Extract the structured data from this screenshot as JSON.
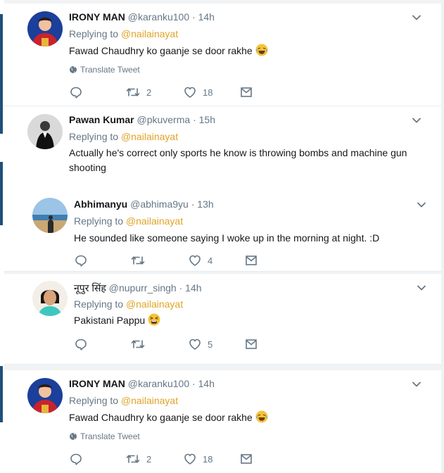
{
  "tweets": [
    {
      "name": "IRONY MAN",
      "handle": "@karanku100",
      "dot": "·",
      "time": "14h",
      "reply_prefix": "Replying to",
      "reply_to": "@nailainayat",
      "text": "Fawad Chaudhry ko gaanje se door rakhe",
      "emoji": "joy",
      "translate": "Translate Tweet",
      "retweets": "2",
      "likes": "18"
    },
    {
      "name": "Pawan Kumar",
      "handle": "@pkuverma",
      "dot": "·",
      "time": "15h",
      "reply_prefix": "Replying to",
      "reply_to": "@nailainayat",
      "text": "Actually he's correct only sports he know is throwing bombs and machine gun shooting"
    },
    {
      "name": "Abhimanyu",
      "handle": "@abhima9yu",
      "dot": "·",
      "time": "13h",
      "reply_prefix": "Replying to",
      "reply_to": "@nailainayat",
      "text": "He sounded like someone saying I woke up in the morning at night. :D",
      "likes": "4"
    },
    {
      "name": "नूपुर सिंह",
      "handle": "@nupurr_singh",
      "dot": "·",
      "time": "14h",
      "reply_prefix": "Replying to",
      "reply_to": "@nailainayat",
      "text": "Pakistani Pappu",
      "emoji": "tired",
      "likes": "5"
    },
    {
      "name": "IRONY MAN",
      "handle": "@karanku100",
      "dot": "·",
      "time": "14h",
      "reply_prefix": "Replying to",
      "reply_to": "@nailainayat",
      "text": "Fawad Chaudhry ko gaanje se door rakhe",
      "emoji": "joy",
      "translate": "Translate Tweet",
      "retweets": "2",
      "likes": "18"
    }
  ],
  "colors": {
    "mention": "#e0a325",
    "secondary": "#657786",
    "primary": "#14171a",
    "divider": "#e6ecf0"
  },
  "icons": [
    "reply-icon",
    "retweet-icon",
    "like-icon",
    "message-icon",
    "globe-icon",
    "chevron-down-icon"
  ]
}
